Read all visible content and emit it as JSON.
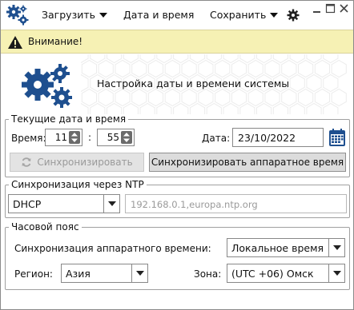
{
  "toolbar": {
    "load_label": "Загрузить",
    "datetime_label": "Дата и время",
    "save_label": "Сохранить"
  },
  "warning": {
    "text": "Внимание!"
  },
  "header": {
    "title": "Настройка даты и времени системы"
  },
  "current": {
    "legend": "Текущие дата и время",
    "time_label": "Время:",
    "hours": "11",
    "separator": ":",
    "minutes": "55",
    "date_label": "Дата:",
    "date_value": "23/10/2022",
    "sync_label": "Синхронизировать",
    "sync_hw_label": "Синхронизировать аппаратное время"
  },
  "ntp": {
    "legend": "Синхронизация через NTP",
    "mode": "DHCP",
    "servers": "192.168.0.1,europa.ntp.org"
  },
  "tz": {
    "legend": "Часовой пояс",
    "hw_label": "Синхронизация аппаратного времени:",
    "hw_value": "Локальное время",
    "region_label": "Регион:",
    "region_value": "Азия",
    "zone_label": "Зона:",
    "zone_value": "(UTC +06) Омск"
  },
  "colors": {
    "accent": "#1e4f8f",
    "warning_bg": "#f6f1b4"
  }
}
